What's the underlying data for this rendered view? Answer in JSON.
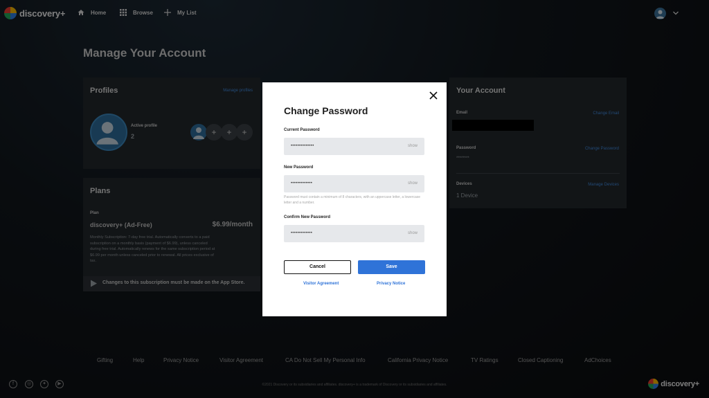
{
  "nav": {
    "logo_text": "discovery+",
    "items": [
      {
        "label": "Home",
        "icon": "home-icon"
      },
      {
        "label": "Browse",
        "icon": "grid-icon"
      },
      {
        "label": "My List",
        "icon": "plus-icon"
      }
    ]
  },
  "page": {
    "title": "Manage Your Account"
  },
  "profiles": {
    "title": "Profiles",
    "manage_link": "Manage profiles",
    "active_label": "Active profile",
    "active_count": "2"
  },
  "plans": {
    "title": "Plans",
    "plan_label": "Plan",
    "plan_name": "discovery+ (Ad-Free)",
    "price": "$6.99/month",
    "description": "Monthly Subscription: 7-day free trial. Automatically converts to a paid subscription on a monthly basis (payment of $6.99), unless canceled during free trial. Automatically renews for the same subscription period at $6.99 per month unless canceled prior to renewal. All prices exclusive of tax.",
    "app_store_note": "Changes to this subscription must be made on the App Store."
  },
  "account": {
    "title": "Your Account",
    "email_label": "Email",
    "change_email": "Change Email",
    "password_label": "Password",
    "password_value": "********",
    "change_password": "Change Password",
    "devices_label": "Devices",
    "manage_devices": "Manage Devices",
    "devices_value": "1 Device"
  },
  "modal": {
    "title": "Change Password",
    "current_label": "Current Password",
    "current_value": "••••••••••••••",
    "new_label": "New Password",
    "new_value": "•••••••••••••",
    "helper": "Password must contain a minimum of 8 characters, with an uppercase letter, a lowercase letter and a number.",
    "confirm_label": "Confirm New Password",
    "confirm_value": "•••••••••••••",
    "show_label": "show",
    "cancel": "Cancel",
    "save": "Save",
    "visitor_agreement": "Visitor Agreement",
    "privacy_notice": "Privacy Notice"
  },
  "footer": {
    "links": [
      "Gifting",
      "Help",
      "Privacy Notice",
      "Visitor Agreement",
      "CA Do Not Sell My Personal Info",
      "California Privacy Notice",
      "TV Ratings",
      "Closed Captioning",
      "AdChoices"
    ],
    "copyright": "©2021 Discovery or its subsidiaries and affiliates. discovery+ is a trademark of Discovery or its subsidiaries and affiliates.",
    "social": [
      "facebook-icon",
      "instagram-icon",
      "twitter-icon",
      "youtube-icon"
    ]
  },
  "colors": {
    "accent": "#2f73d8",
    "link": "#3f86d8",
    "card": "#22272b"
  }
}
